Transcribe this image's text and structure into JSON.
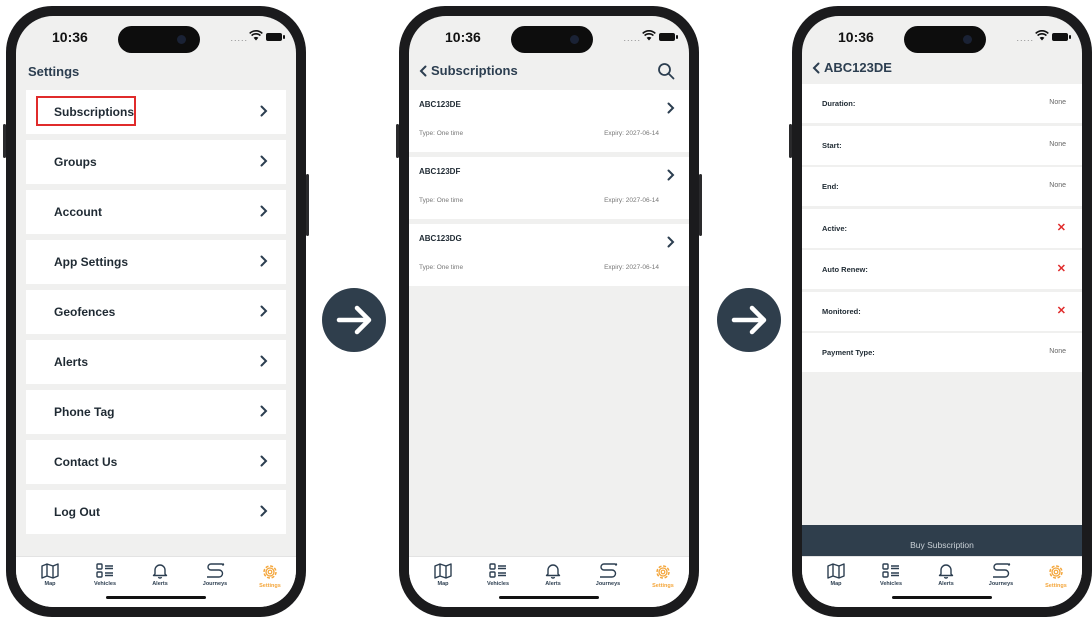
{
  "colors": {
    "accent": "#f4a63b",
    "navy": "#2f3e4c",
    "highlight": "#e02b2b",
    "danger": "#e02b2b"
  },
  "status": {
    "time": "10:36",
    "signal": "....."
  },
  "tabs": [
    {
      "label": "Map",
      "icon": "map-icon"
    },
    {
      "label": "Vehicles",
      "icon": "vehicles-icon"
    },
    {
      "label": "Alerts",
      "icon": "bell-icon"
    },
    {
      "label": "Journeys",
      "icon": "journeys-icon"
    },
    {
      "label": "Settings",
      "icon": "gear-icon",
      "active": true
    }
  ],
  "screen1": {
    "title": "Settings",
    "items": [
      "Subscriptions",
      "Groups",
      "Account",
      "App Settings",
      "Geofences",
      "Alerts",
      "Phone Tag",
      "Contact Us",
      "Log Out"
    ]
  },
  "screen2": {
    "title": "Subscriptions",
    "subscriptions": [
      {
        "code": "ABC123DE",
        "type": "Type: One time",
        "expiry": "Expiry: 2027-06-14"
      },
      {
        "code": "ABC123DF",
        "type": "Type: One time",
        "expiry": "Expiry: 2027-06-14"
      },
      {
        "code": "ABC123DG",
        "type": "Type: One time",
        "expiry": "Expiry: 2027-06-14"
      }
    ]
  },
  "screen3": {
    "title": "ABC123DE",
    "fields": [
      {
        "label": "Duration:",
        "value": "None"
      },
      {
        "label": "Start:",
        "value": "None"
      },
      {
        "label": "End:",
        "value": "None"
      },
      {
        "label": "Active:",
        "value": "✕"
      },
      {
        "label": "Auto Renew:",
        "value": "✕"
      },
      {
        "label": "Monitored:",
        "value": "✕"
      },
      {
        "label": "Payment Type:",
        "value": "None"
      }
    ],
    "buy_label": "Buy Subscription"
  }
}
